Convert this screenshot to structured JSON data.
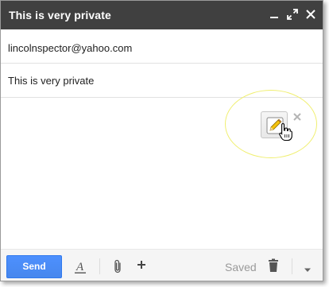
{
  "window": {
    "title": "This is very private"
  },
  "titlebar_icons": {
    "minimize": "minimize-icon",
    "expand": "expand-icon",
    "close": "close-icon"
  },
  "fields": {
    "to_value": "lincolnspector@yahoo.com",
    "subject_value": "This is very private"
  },
  "popup": {
    "edit_icon": "pencil-edit-icon",
    "dismiss_icon": "close-x-icon"
  },
  "footer": {
    "send_label": "Send",
    "saved_label": "Saved",
    "icons": [
      "text-format-icon",
      "attachment-icon",
      "plus-icon",
      "trash-icon",
      "chevron-down-icon"
    ]
  },
  "colors": {
    "titlebar": "#404040",
    "send_button": "#4d90fe",
    "highlight_ring": "#f0ef70"
  }
}
